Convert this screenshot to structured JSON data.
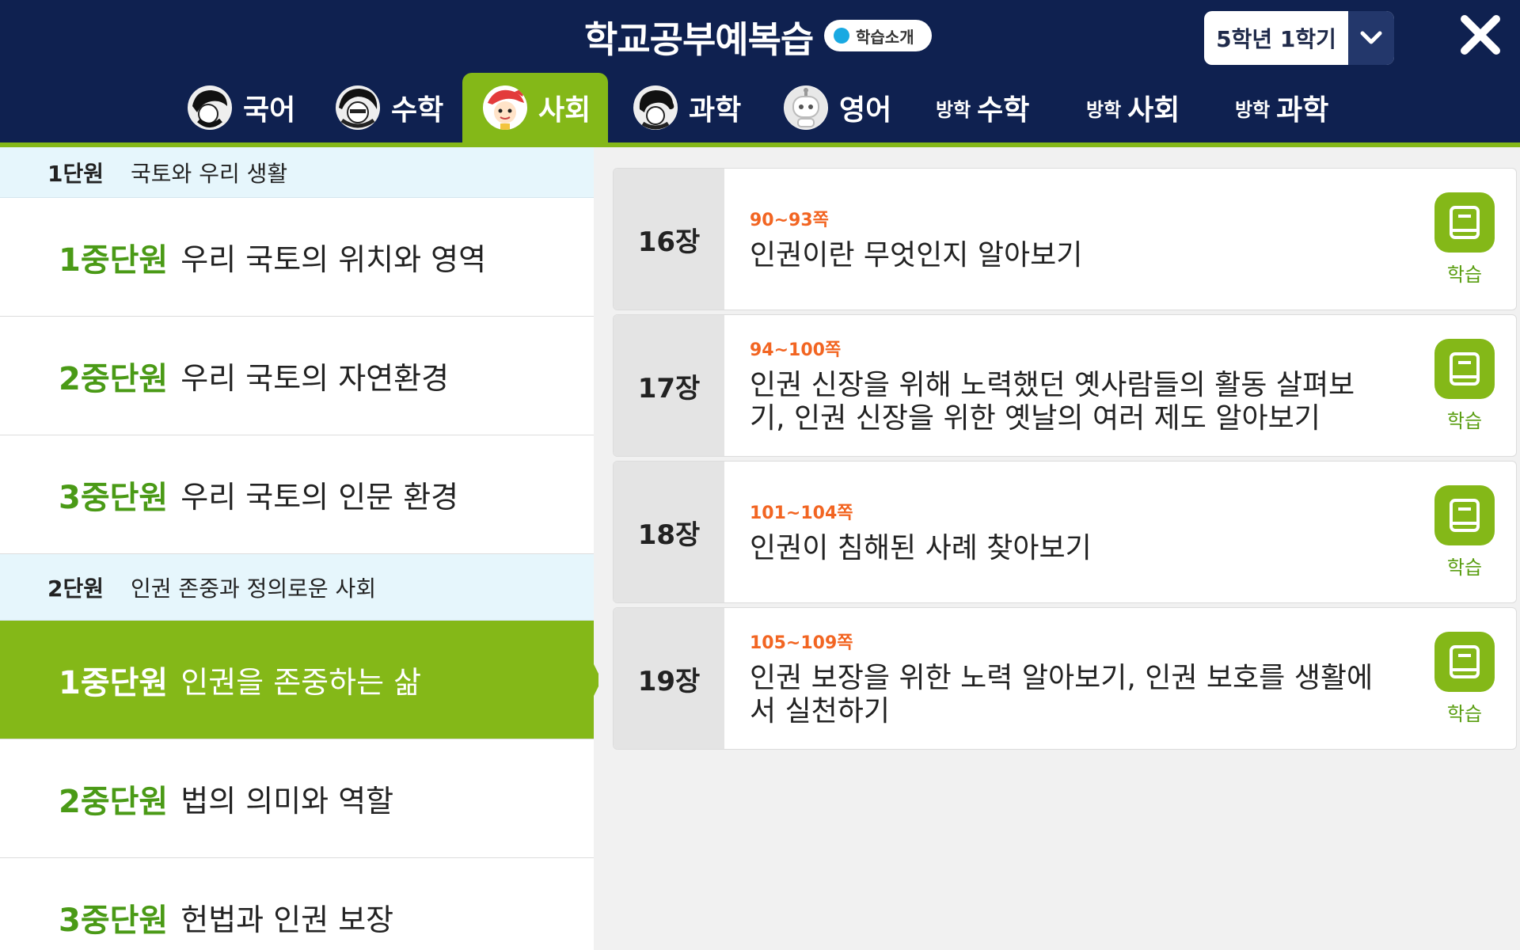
{
  "header": {
    "title": "학교공부예복습",
    "intro_label": "학습소개",
    "grade_label": "5학년 1학기",
    "tabs": [
      {
        "label": "국어",
        "prefix": ""
      },
      {
        "label": "수학",
        "prefix": ""
      },
      {
        "label": "사회",
        "prefix": "",
        "active": true
      },
      {
        "label": "과학",
        "prefix": ""
      },
      {
        "label": "영어",
        "prefix": ""
      },
      {
        "label": "수학",
        "prefix": "방학"
      },
      {
        "label": "사회",
        "prefix": "방학"
      },
      {
        "label": "과학",
        "prefix": "방학"
      }
    ]
  },
  "units": [
    {
      "num": "1단원",
      "title": "국토와 우리 생활",
      "subunits": [
        {
          "num": "1중단원",
          "title": "우리 국토의 위치와 영역"
        },
        {
          "num": "2중단원",
          "title": "우리 국토의 자연환경"
        },
        {
          "num": "3중단원",
          "title": "우리 국토의 인문 환경"
        }
      ]
    },
    {
      "num": "2단원",
      "title": "인권 존중과 정의로운 사회",
      "subunits": [
        {
          "num": "1중단원",
          "title": "인권을 존중하는 삶",
          "selected": true
        },
        {
          "num": "2중단원",
          "title": "법의 의미와 역할"
        },
        {
          "num": "3중단원",
          "title": "헌법과 인권 보장"
        }
      ]
    }
  ],
  "chapters": [
    {
      "chapter": "16장",
      "pages": "90~93쪽",
      "title": "인권이란 무엇인지 알아보기",
      "study_label": "학습"
    },
    {
      "chapter": "17장",
      "pages": "94~100쪽",
      "title": "인권 신장을 위해 노력했던 옛사람들의 활동 살펴보기, 인권 신장을 위한 옛날의 여러 제도 알아보기",
      "study_label": "학습"
    },
    {
      "chapter": "18장",
      "pages": "101~104쪽",
      "title": "인권이 침해된 사례 찾아보기",
      "study_label": "학습"
    },
    {
      "chapter": "19장",
      "pages": "105~109쪽",
      "title": "인권 보장을 위한 노력 알아보기, 인권 보호를 생활에서 실천하기",
      "study_label": "학습"
    }
  ],
  "colors": {
    "header_bg": "#0f2150",
    "accent_green": "#84b818",
    "unit_header_bg": "#e6f6fc",
    "page_range": "#f26522",
    "badge_dot": "#19a9e2"
  },
  "icons": {
    "close": "close-icon",
    "dropdown": "chevron-down-icon",
    "study": "book-icon"
  }
}
